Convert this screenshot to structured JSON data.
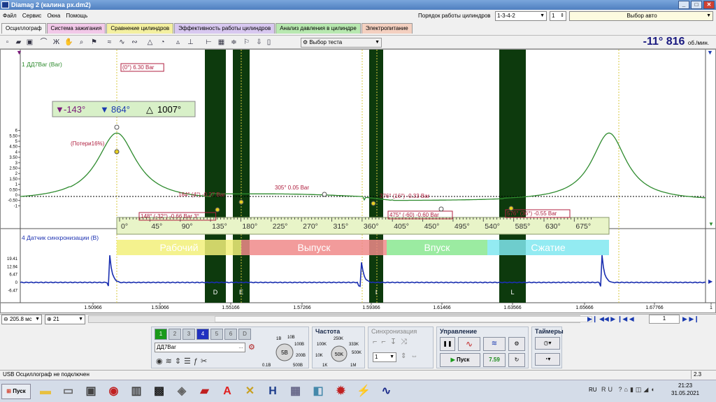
{
  "window": {
    "title": "Diamag 2 (калина px.dm2)"
  },
  "menu": [
    "Файл",
    "Сервис",
    "Окна",
    "Помощь"
  ],
  "header": {
    "cyl_order_label": "Порядок работы цилиндров",
    "cyl_order_value": "1-3-4-2",
    "cyl_num": "1",
    "auto_select": "Выбор авто"
  },
  "tabs": [
    {
      "label": "Осциллограф",
      "color": "#f4f4f4"
    },
    {
      "label": "Система зажигания",
      "color": "#f2c8e8"
    },
    {
      "label": "Сравнение цилиндров",
      "color": "#f4f0a0"
    },
    {
      "label": "Эффективность работы цилиндров",
      "color": "#d8c8f0"
    },
    {
      "label": "Анализ давления в цилиндре",
      "color": "#b8e8b0"
    },
    {
      "label": "Электропитание",
      "color": "#f4d0c0"
    }
  ],
  "toolbar": {
    "test_select": "Выбор теста"
  },
  "rpm": {
    "angle": "-11°",
    "value": "816",
    "unit": "об./мин."
  },
  "channel1": {
    "label": "1 ДД7Bar (Bar)",
    "color": "#2e8b2e",
    "y_ticks": [
      "6",
      "5.50",
      "5",
      "4.50",
      "4",
      "3.50",
      "3",
      "2.50",
      "2",
      "1.50",
      "1",
      "0.50",
      "0",
      "-0.50",
      "-1"
    ]
  },
  "channel2": {
    "label": "4 Датчик синхронизации (B)",
    "color": "#1a2fb0",
    "y_ticks": [
      "19.41",
      "12.94",
      "6.47",
      "0",
      "-6.47"
    ]
  },
  "cursors": {
    "left": "-143°",
    "right": "864°",
    "delta": "1007°"
  },
  "annotations": {
    "peak": "(0°) 6.30 Bar",
    "loss": "(Потери16%)",
    "a1": "184° (4°) -0.27 Bar",
    "a2": "148° (-32°) -0.66 Bar 3°",
    "a3": "305° 0.05 Bar",
    "a4": "376° (16°) -0.33 Bar",
    "a5": "475° (-60) -0.60 Bar",
    "a6": "576° (36°) -0.55 Bar"
  },
  "angle_scale": [
    "0°",
    "45°",
    "90°",
    "135°",
    "180°",
    "225°",
    "270°",
    "315°",
    "360°",
    "405°",
    "450°",
    "495°",
    "540°",
    "585°",
    "630°",
    "675°"
  ],
  "phases": [
    {
      "label": "Рабочий",
      "color": "#f2f07a"
    },
    {
      "label": "Выпуск",
      "color": "#f08a8a"
    },
    {
      "label": "Впуск",
      "color": "#8ae890"
    },
    {
      "label": "Сжатие",
      "color": "#80e8f0"
    }
  ],
  "markers": [
    "D",
    "E",
    "I",
    "L"
  ],
  "x_ticks": [
    "1.50966",
    "1.53066",
    "1.55166",
    "1.57266",
    "1.59366",
    "1.61466",
    "1.63566",
    "1.65666",
    "1.67766",
    "1"
  ],
  "bottom": {
    "timebase": "205.8 мс",
    "ch": "21",
    "page": "1"
  },
  "controls": {
    "channels": [
      "1",
      "2",
      "3",
      "4",
      "5",
      "6",
      "D"
    ],
    "sensor": "ДД7Bar",
    "range_labels": [
      "1В",
      "10В",
      "100В",
      "200В",
      "500В",
      "0.1В"
    ],
    "range_value": "5В",
    "freq_title": "Частота",
    "freq_labels": [
      "250K",
      "100K",
      "333K",
      "10K",
      "500K",
      "1K",
      "1M"
    ],
    "freq_value": "50K",
    "sync_title": "Синхронизация",
    "sync_value": "1",
    "control_title": "Управление",
    "start": "Пуск",
    "fps": "7.59",
    "timers_title": "Таймеры"
  },
  "status": {
    "left": "USB Осциллограф не подключен",
    "right": "2.3"
  },
  "taskbar": {
    "start": "Пуск",
    "lang": "RU",
    "time": "21:23",
    "date": "31.05.2021"
  }
}
